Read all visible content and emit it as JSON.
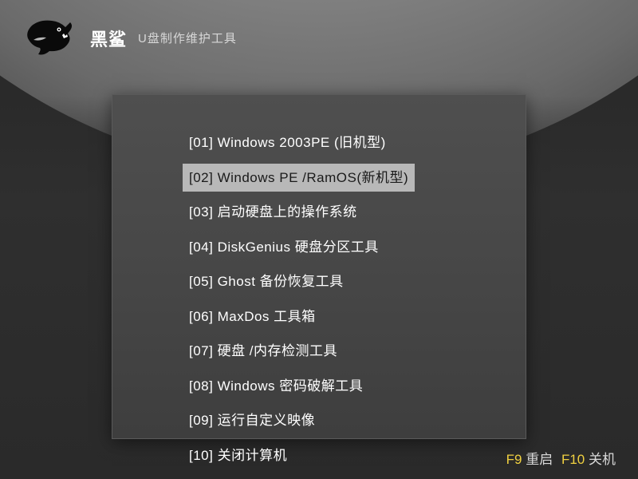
{
  "brand": "黑鲨",
  "subtitle": "U盘制作维护工具",
  "menu": {
    "selectedIndex": 1,
    "items": [
      "[01] Windows 2003PE (旧机型)",
      "[02] Windows PE /RamOS(新机型)",
      "[03] 启动硬盘上的操作系统",
      "[04] DiskGenius 硬盘分区工具",
      "[05] Ghost 备份恢复工具",
      "[06] MaxDos 工具箱",
      "[07] 硬盘 /内存检测工具",
      "[08] Windows 密码破解工具",
      "[09] 运行自定义映像",
      "[10] 关闭计算机"
    ]
  },
  "footer": {
    "key1": "F9",
    "action1": "重启",
    "key2": "F10",
    "action2": "关机"
  }
}
